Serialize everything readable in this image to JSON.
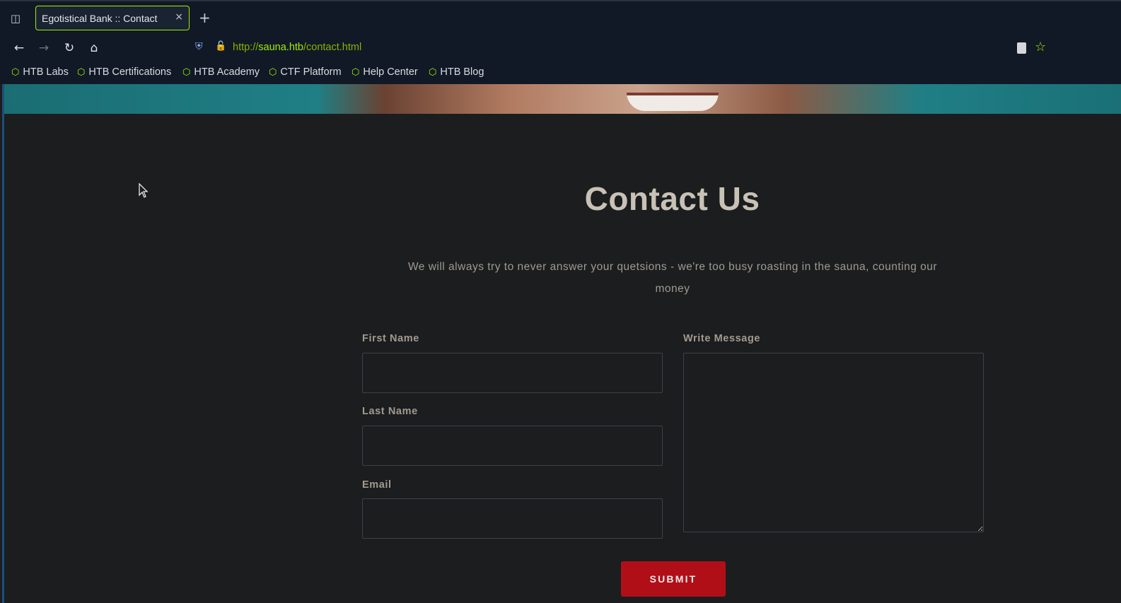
{
  "browser": {
    "tab": {
      "title": "Egotistical Bank :: Contact",
      "close": "×"
    },
    "new_tab": "+",
    "url": {
      "scheme": "http://",
      "host": "sauna.htb",
      "path": "/contact.html"
    },
    "bookmarks": [
      {
        "label": "HTB Labs",
        "icon": "htb-cube-icon"
      },
      {
        "label": "HTB Certifications",
        "icon": "htb-cube-icon"
      },
      {
        "label": "HTB Academy",
        "icon": "htb-cube-icon"
      },
      {
        "label": "CTF Platform",
        "icon": "htb-cube-icon"
      },
      {
        "label": "Help Center",
        "icon": "htb-cube-icon"
      },
      {
        "label": "HTB Blog",
        "icon": "htb-cube-icon"
      }
    ]
  },
  "page": {
    "title": "Contact Us",
    "subtitle": "We will always try to never answer your quetsions - we're too busy roasting in the sauna, counting our money",
    "form": {
      "first_name_label": "First Name",
      "last_name_label": "Last Name",
      "email_label": "Email",
      "message_label": "Write Message",
      "first_name_value": "",
      "last_name_value": "",
      "email_value": "",
      "message_value": "",
      "submit_label": "SUBMIT"
    }
  },
  "colors": {
    "accent": "#9fef00",
    "chrome_bg": "#111927",
    "page_bg": "#1b1d1f",
    "submit_bg": "#b10f18"
  }
}
